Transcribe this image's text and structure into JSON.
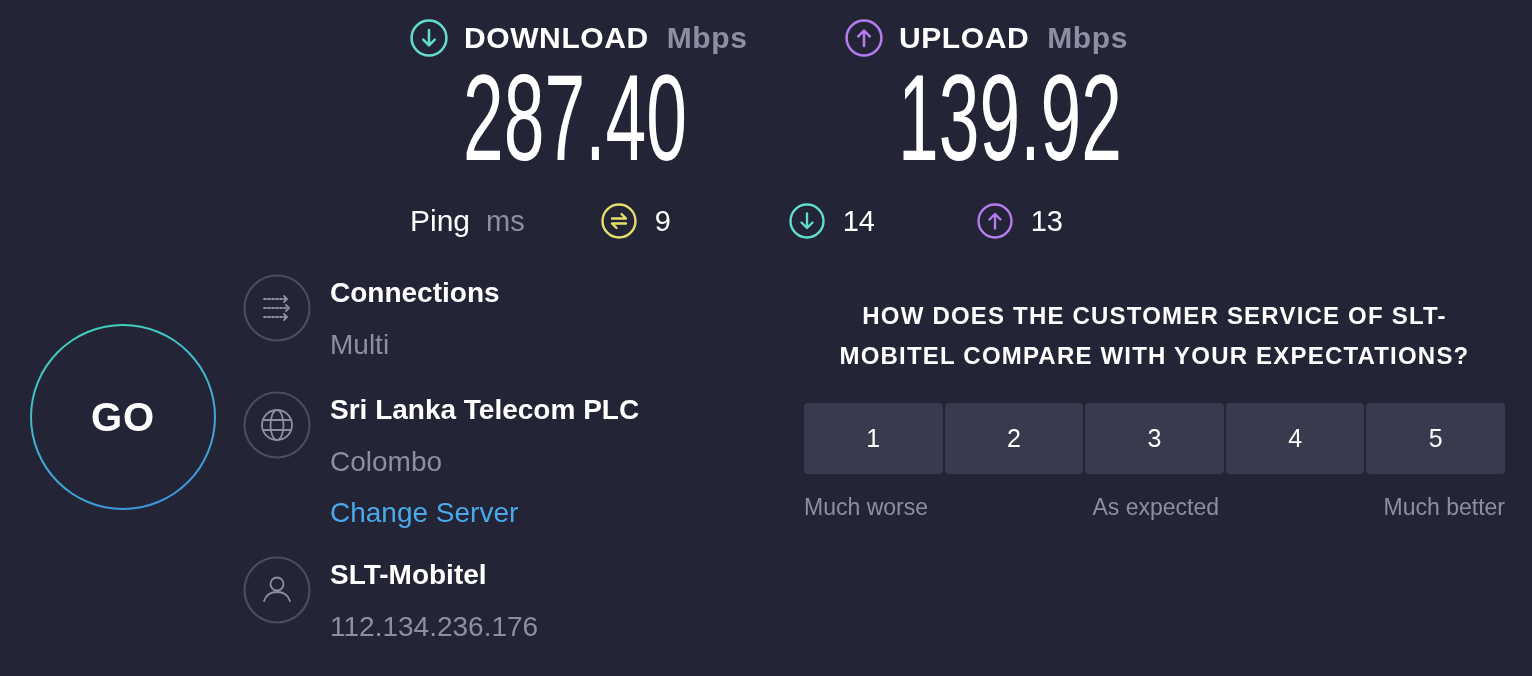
{
  "results": [
    {
      "kind": "download",
      "label": "DOWNLOAD",
      "unit": "Mbps",
      "value": "287.40"
    },
    {
      "kind": "upload",
      "label": "UPLOAD",
      "unit": "Mbps",
      "value": "139.92"
    }
  ],
  "ping": {
    "label": "Ping",
    "unit": "ms",
    "readings": [
      {
        "kind": "idle",
        "value": "9"
      },
      {
        "kind": "download",
        "value": "14"
      },
      {
        "kind": "upload",
        "value": "13"
      }
    ]
  },
  "go_button": {
    "label": "GO"
  },
  "connection": [
    {
      "kind": "connections",
      "title": "Connections",
      "detail": "Multi"
    },
    {
      "kind": "server",
      "title": "Sri Lanka Telecom PLC",
      "detail": "Colombo",
      "link": "Change Server"
    },
    {
      "kind": "provider",
      "title": "SLT-Mobitel",
      "detail": "112.134.236.176"
    }
  ],
  "survey": {
    "question": "HOW DOES THE CUSTOMER SERVICE OF SLT-MOBITEL COMPARE WITH YOUR EXPECTATIONS?",
    "options": [
      {
        "label": "1",
        "selected": false
      },
      {
        "label": "2",
        "selected": false
      },
      {
        "label": "3",
        "selected": false
      },
      {
        "label": "4",
        "selected": false
      },
      {
        "label": "5",
        "selected": false
      }
    ],
    "scale_labels": [
      "Much worse",
      "As expected",
      "Much better"
    ]
  }
}
